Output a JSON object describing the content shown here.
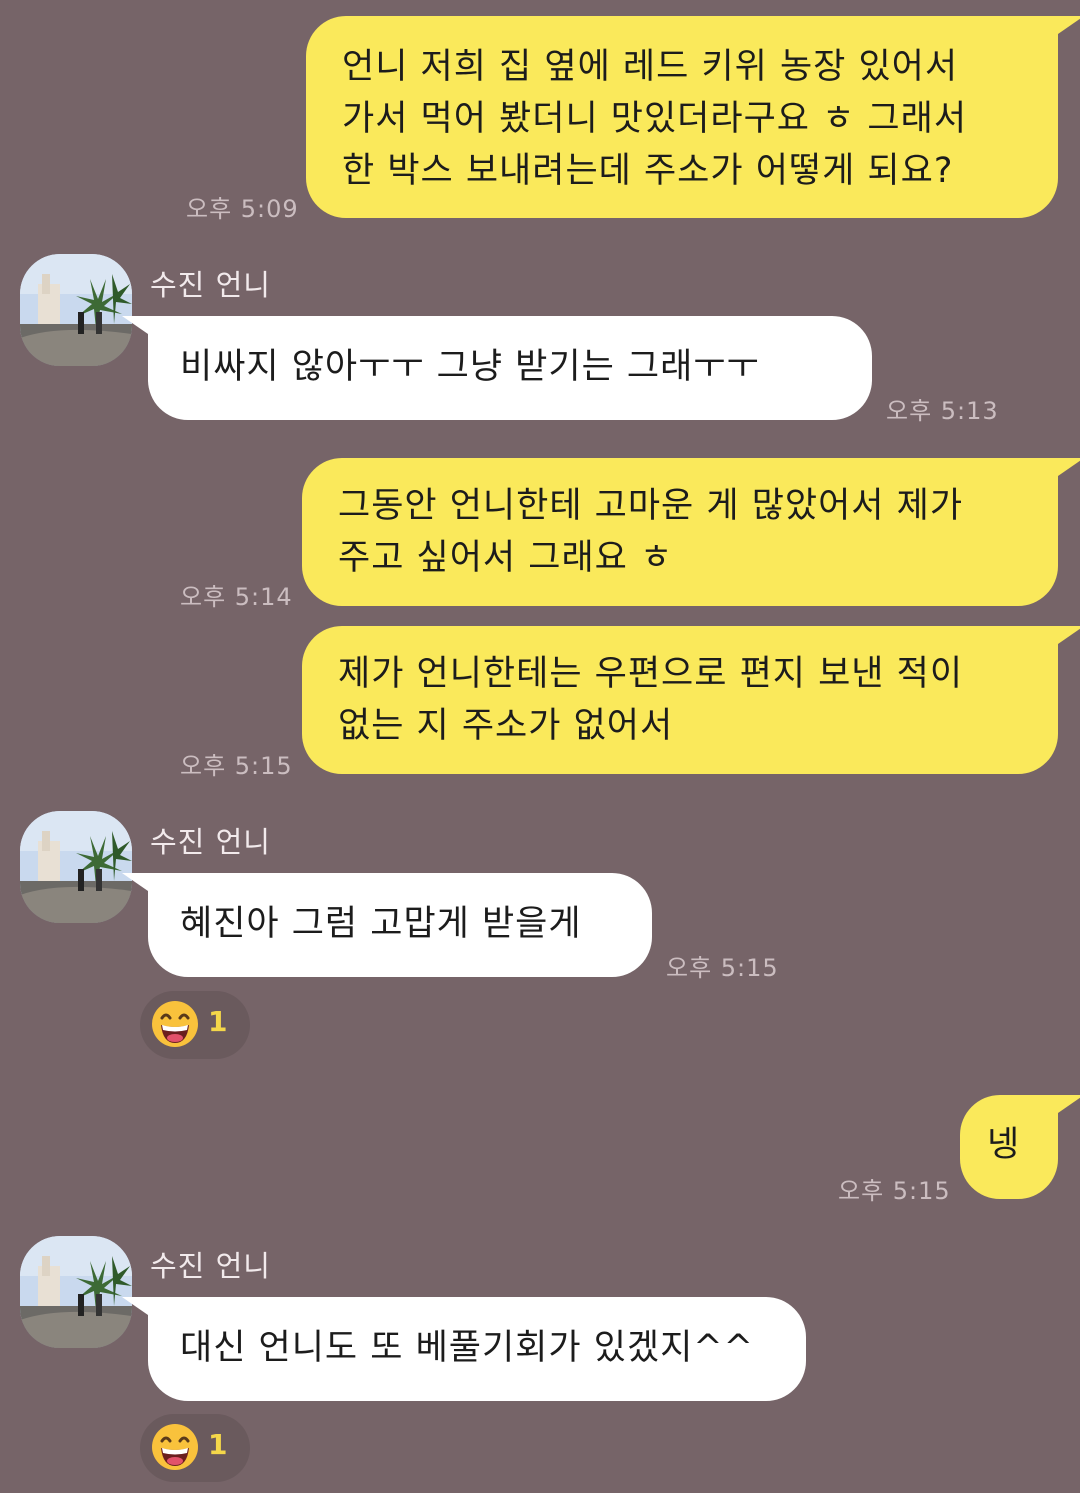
{
  "messages": [
    {
      "id": "m1",
      "side": "mine",
      "lines": [
        "언니 저희 집 옆에 레드 키위 농장 있어서",
        "가서 먹어 봤더니 맛있더라구요 ㅎ 그래서",
        "한 박스 보내려는데 주소가 어떻게 되요?"
      ],
      "time": "오후 5:09"
    },
    {
      "id": "m2",
      "side": "theirs",
      "sender": "수진 언니",
      "lines": [
        "비싸지 않아ㅜㅜ 그냥 받기는 그래ㅜㅜ"
      ],
      "time": "오후 5:13"
    },
    {
      "id": "m3",
      "side": "mine",
      "lines": [
        "그동안 언니한테 고마운 게 많았어서 제가",
        "주고 싶어서 그래요 ㅎ"
      ],
      "time": "오후 5:14"
    },
    {
      "id": "m4",
      "side": "mine",
      "lines": [
        "제가 언니한테는 우편으로 편지 보낸 적이",
        "없는 지 주소가 없어서"
      ],
      "time": "오후 5:15"
    },
    {
      "id": "m5",
      "side": "theirs",
      "sender": "수진 언니",
      "lines": [
        "혜진아 그럼 고맙게 받을게"
      ],
      "time": "오후 5:15",
      "reaction": {
        "emoji": "grinning-face-emoji",
        "count": "1"
      }
    },
    {
      "id": "m6",
      "side": "mine",
      "lines": [
        "넹"
      ],
      "time": "오후 5:15"
    },
    {
      "id": "m7",
      "side": "theirs",
      "sender": "수진 언니",
      "lines": [
        "대신 언니도 또 베풀기회가 있겠지^^"
      ],
      "reaction": {
        "emoji": "grinning-face-emoji",
        "count": "1"
      }
    }
  ],
  "colors": {
    "background": "#766468",
    "my_bubble": "#fae95b",
    "their_bubble": "#ffffff",
    "reaction_count": "#f4d74a"
  }
}
